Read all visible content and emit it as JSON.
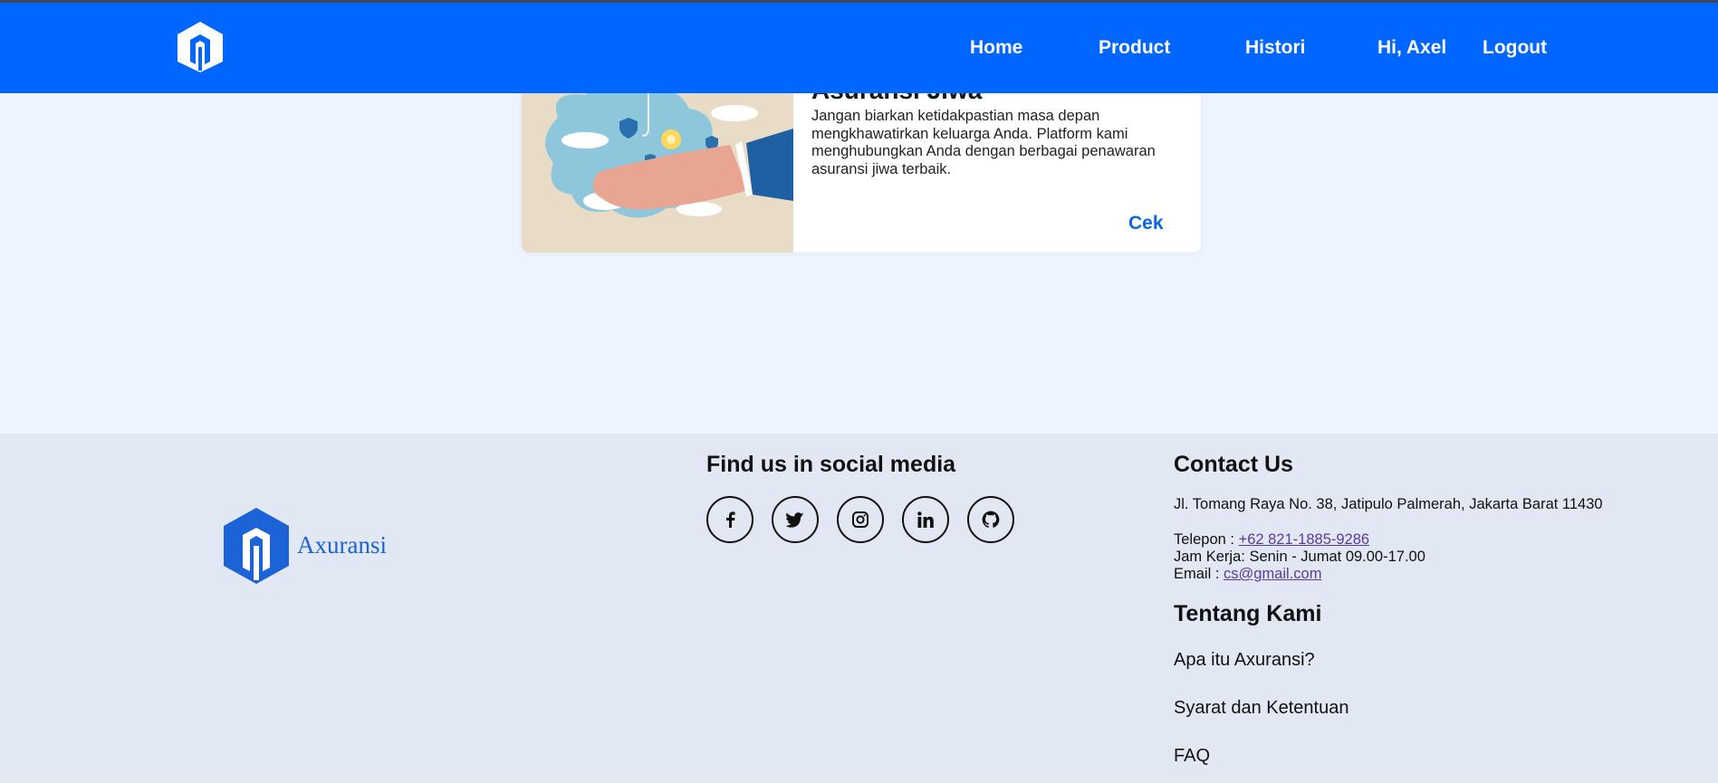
{
  "navbar": {
    "logo_icon": "brand-logo-icon",
    "links": [
      {
        "label": "Home"
      },
      {
        "label": "Product"
      },
      {
        "label": "Histori"
      },
      {
        "label": "Hi, Axel"
      },
      {
        "label": "Logout"
      }
    ],
    "background_color": "#0066ff"
  },
  "card": {
    "title": "Asuransi Jiwa",
    "image_icon": "life-insurance-illustration",
    "description": "Jangan biarkan ketidakpastian masa depan mengkhawatirkan keluarga Anda. Platform kami menghubungkan Anda dengan berbagai penawaran asuransi jiwa terbaik.",
    "cta_label": "Cek"
  },
  "footer": {
    "brand_name": "Axuransi",
    "social": {
      "heading": "Find us in social media",
      "icons": [
        "facebook-icon",
        "twitter-icon",
        "instagram-icon",
        "linkedin-icon",
        "github-icon"
      ]
    },
    "contact": {
      "heading": "Contact Us",
      "address": "Jl. Tomang Raya No. 38, Jatipulo Palmerah, Jakarta Barat 11430",
      "phone_label": "Telepon : ",
      "phone_value": "+62 821-1885-9286",
      "hours": "Jam Kerja: Senin - Jumat 09.00-17.00",
      "email_label": "Email : ",
      "email_value": "cs@gmail.com"
    },
    "about": {
      "heading": "Tentang Kami",
      "links": [
        "Apa itu Axuransi?",
        "Syarat dan Ketentuan",
        "FAQ"
      ]
    },
    "background_color": "#e1e8f4"
  }
}
